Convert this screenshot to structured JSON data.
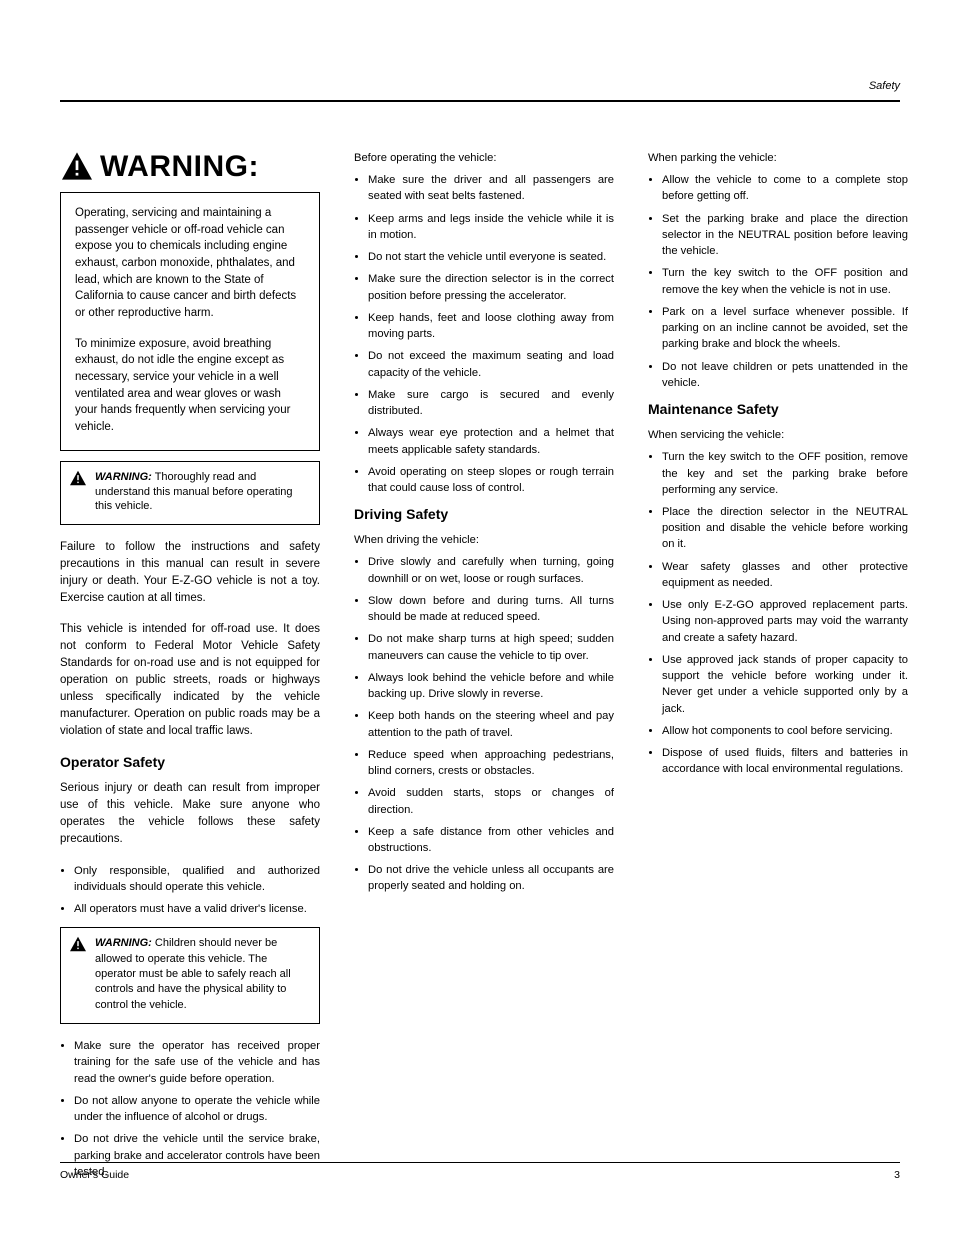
{
  "header_right": "Safety",
  "warning_title": "WARNING:",
  "framed1": {
    "p1": "Operating, servicing and maintaining a passenger vehicle or off-road vehicle can expose you to chemicals including engine exhaust, carbon monoxide, phthalates, and lead, which are known to the State of California to cause cancer and birth defects or other reproductive harm.",
    "p2": "To minimize exposure, avoid breathing exhaust, do not idle the engine except as necessary, service your vehicle in a well ventilated area and wear gloves or wash your hands frequently when servicing your vehicle."
  },
  "small_warn1": {
    "label": "WARNING:",
    "text": "Thoroughly read and understand this manual before operating this vehicle."
  },
  "col1_p1": "Failure to follow the instructions and safety precautions in this manual can result in severe injury or death. Your E-Z-GO vehicle is not a toy. Exercise caution at all times.",
  "col1_p2": "This vehicle is intended for off-road use. It does not conform to Federal Motor Vehicle Safety Standards for on-road use and is not equipped for operation on public streets, roads or highways unless specifically indicated by the vehicle manufacturer. Operation on public roads may be a violation of state and local traffic laws.",
  "col1_h2": "Operator Safety",
  "col1_p3": "Serious injury or death can result from improper use of this vehicle. Make sure anyone who operates the vehicle follows these safety precautions.",
  "ul1": [
    "Only responsible, qualified and authorized individuals should operate this vehicle.",
    "All operators must have a valid driver's license."
  ],
  "small_warn2": {
    "label": "WARNING:",
    "text": "Children should never be allowed to operate this vehicle. The operator must be able to safely reach all controls and have the physical ability to control the vehicle."
  },
  "ul2": [
    "Make sure the operator has received proper training for the safe use of the vehicle and has read the owner's guide before operation.",
    "Do not allow anyone to operate the vehicle while under the influence of alcohol or drugs.",
    "Do not drive the vehicle until the service brake, parking brake and accelerator controls have been tested."
  ],
  "col2_list_head": "Before operating the vehicle:",
  "ul3": [
    "Make sure the driver and all passengers are seated with seat belts fastened.",
    "Keep arms and legs inside the vehicle while it is in motion.",
    "Do not start the vehicle until everyone is seated.",
    "Make sure the direction selector is in the correct position before pressing the accelerator.",
    "Keep hands, feet and loose clothing away from moving parts.",
    "Do not exceed the maximum seating and load capacity of the vehicle.",
    "Make sure cargo is secured and evenly distributed.",
    "Always wear eye protection and a helmet that meets applicable safety standards.",
    "Avoid operating on steep slopes or rough terrain that could cause loss of control."
  ],
  "col2_h2": "Driving Safety",
  "col2_list_head2": "When driving the vehicle:",
  "ul4": [
    "Drive slowly and carefully when turning, going downhill or on wet, loose or rough surfaces.",
    "Slow down before and during turns. All turns should be made at reduced speed.",
    "Do not make sharp turns at high speed; sudden maneuvers can cause the vehicle to tip over.",
    "Always look behind the vehicle before and while backing up. Drive slowly in reverse.",
    "Keep both hands on the steering wheel and pay attention to the path of travel.",
    "Reduce speed when approaching pedestrians, blind corners, crests or obstacles.",
    "Avoid sudden starts, stops or changes of direction.",
    "Keep a safe distance from other vehicles and obstructions.",
    "Do not drive the vehicle unless all occupants are properly seated and holding on."
  ],
  "col3_list_head": "When parking the vehicle:",
  "ul5": [
    "Allow the vehicle to come to a complete stop before getting off.",
    "Set the parking brake and place the direction selector in the NEUTRAL position before leaving the vehicle.",
    "Turn the key switch to the OFF position and remove the key when the vehicle is not in use.",
    "Park on a level surface whenever possible. If parking on an incline cannot be avoided, set the parking brake and block the wheels.",
    "Do not leave children or pets unattended in the vehicle."
  ],
  "col3_h2": "Maintenance Safety",
  "col3_list_head2": "When servicing the vehicle:",
  "ul6": [
    "Turn the key switch to the OFF position, remove the key and set the parking brake before performing any service.",
    "Place the direction selector in the NEUTRAL position and disable the vehicle before working on it.",
    "Wear safety glasses and other protective equipment as needed.",
    "Use only E-Z-GO approved replacement parts. Using non-approved parts may void the warranty and create a safety hazard.",
    "Use approved jack stands of proper capacity to support the vehicle before working under it. Never get under a vehicle supported only by a jack.",
    "Allow hot components to cool before servicing.",
    "Dispose of used fluids, filters and batteries in accordance with local environmental regulations."
  ],
  "footer_left": "Owner's Guide",
  "footer_right": "3"
}
